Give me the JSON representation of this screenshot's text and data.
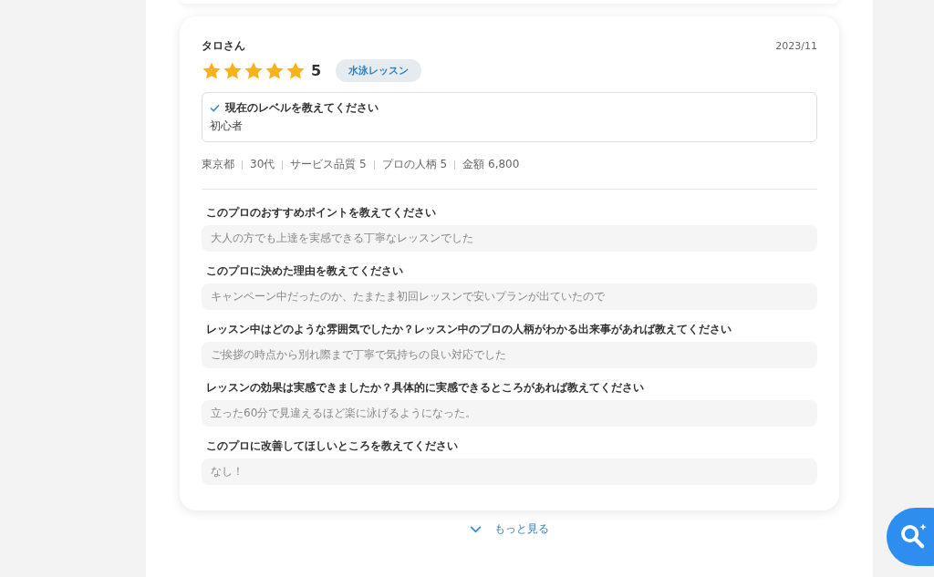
{
  "review": {
    "author": "タロさん",
    "date": "2023/11",
    "stars": 5,
    "rating": "5",
    "tag": "水泳レッスン",
    "level_question": {
      "question": "現在のレベルを教えてください",
      "answer": "初心者"
    },
    "meta": [
      "東京都",
      "30代",
      "サービス品質 5",
      "プロの人柄 5",
      "金額 6,800"
    ],
    "qa": [
      {
        "question": "このプロのおすすめポイントを教えてください",
        "answer": "大人の方でも上達を実感できる丁寧なレッスンでした"
      },
      {
        "question": "このプロに決めた理由を教えてください",
        "answer": "キャンペーン中だったのか、たまたま初回レッスンで安いプランが出ていたので"
      },
      {
        "question": "レッスン中はどのような雰囲気でしたか？レッスン中のプロの人柄がわかる出来事があれば教えてください",
        "answer": "ご挨拶の時点から別れ際まで丁寧で気持ちの良い対応でした"
      },
      {
        "question": "レッスンの効果は実感できましたか？具体的に実感できるところがあれば教えてください",
        "answer": "立った60分で見違えるほど楽に泳げるようになった。"
      },
      {
        "question": "このプロに改善してほしいところを教えてください",
        "answer": "なし！"
      }
    ]
  },
  "more_link": "もっと見る"
}
